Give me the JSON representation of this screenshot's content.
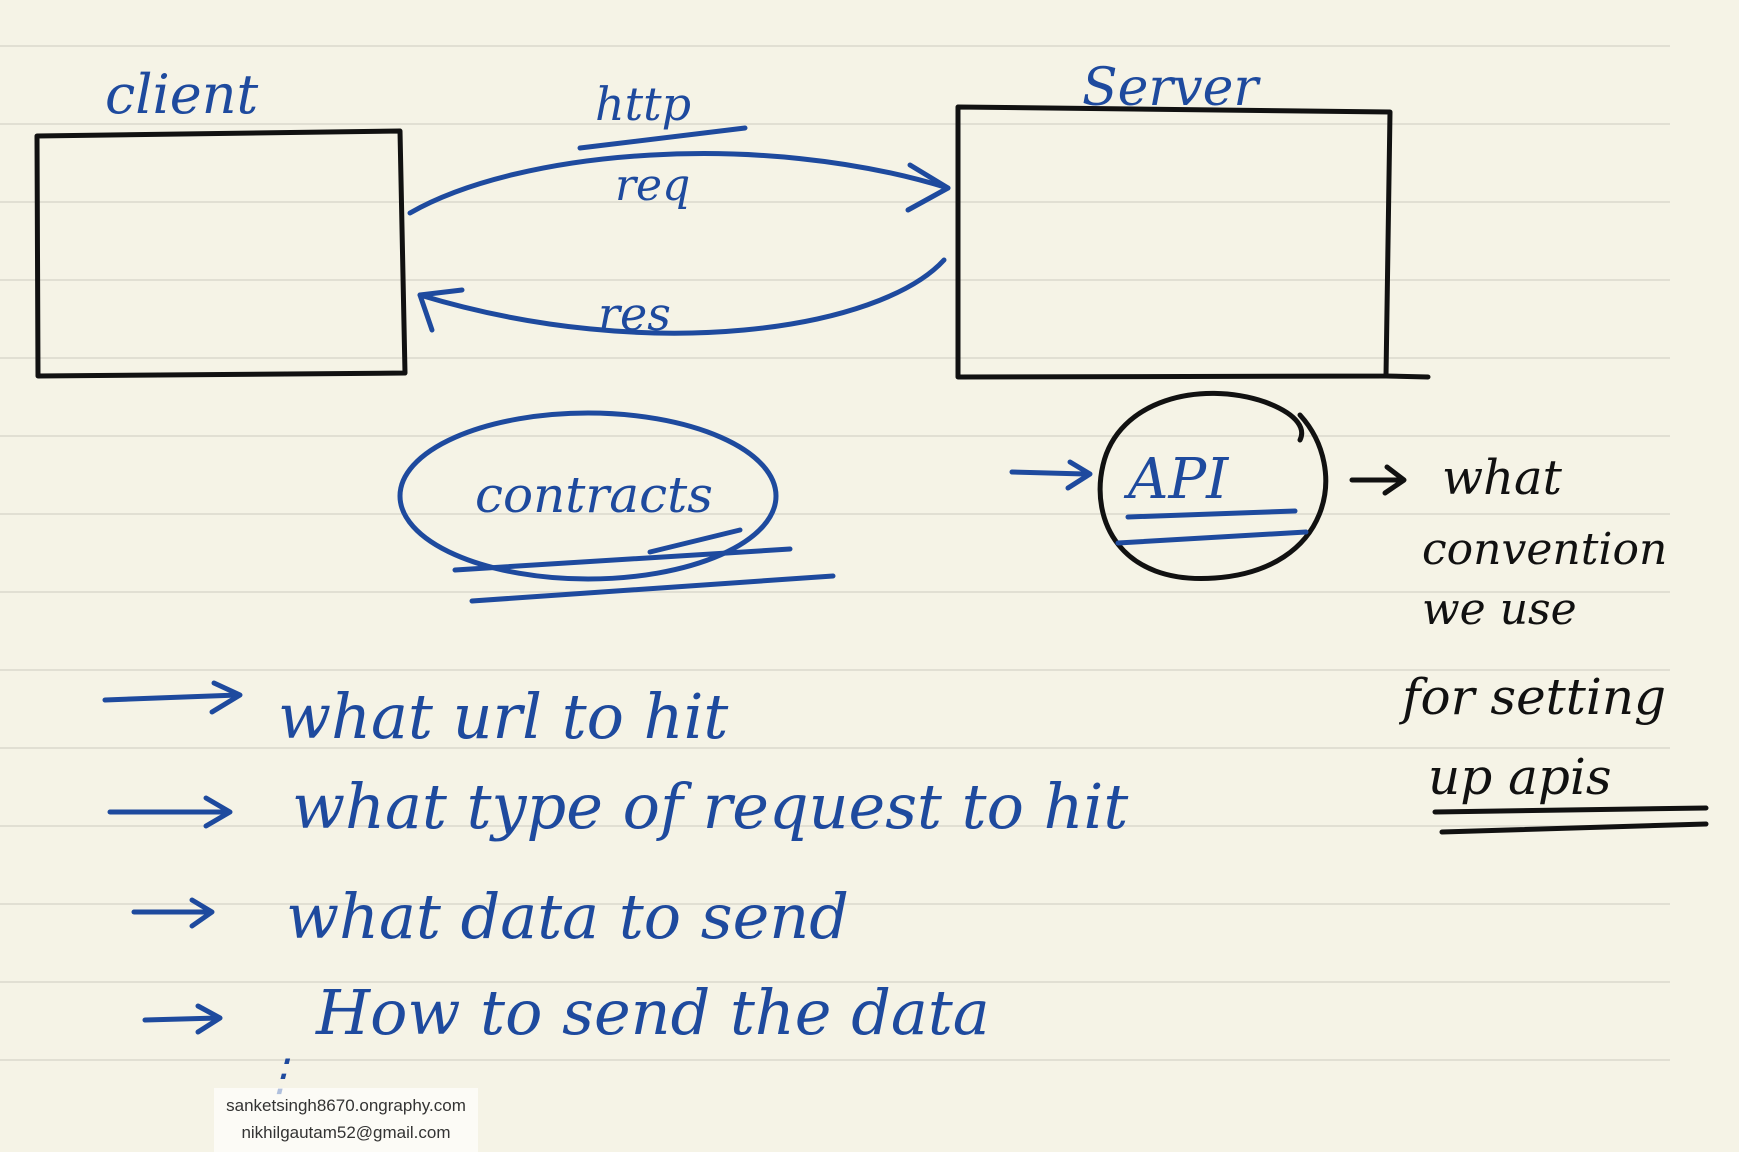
{
  "nodes": {
    "client": {
      "label": "client"
    },
    "server": {
      "label": "Server"
    },
    "contracts": {
      "label": "contracts"
    },
    "api": {
      "label": "API"
    }
  },
  "edges": {
    "request": {
      "label": "req",
      "protocol": "http"
    },
    "response": {
      "label": "res"
    }
  },
  "contract_items": [
    "what url to hit",
    "what type of request to hit",
    "what data to send",
    "How to send the data"
  ],
  "list_continuation": "⋮",
  "api_note": [
    "what",
    "convention",
    "we use",
    "for setting",
    "up apis"
  ],
  "watermark": {
    "line1": "sanketsingh8670.ongraphy.com",
    "line2": "nikhilgautam52@gmail.com"
  },
  "colors": {
    "ink_blue": "#1e4a9e",
    "ink_black": "#111111",
    "paper": "#f5f3e6",
    "rule_line": "#e1dfd3"
  }
}
